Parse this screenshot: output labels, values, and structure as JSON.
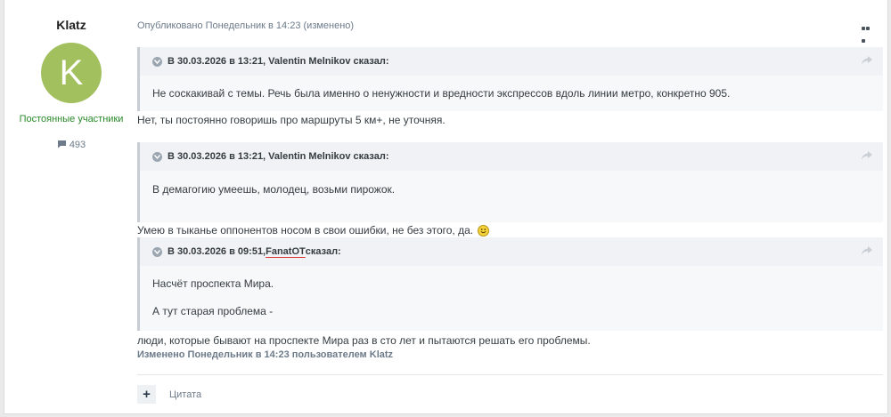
{
  "author": {
    "name": "Klatz",
    "avatar_letter": "K",
    "avatar_color": "#a3c05f",
    "group": "Постоянные участники",
    "post_count": "493"
  },
  "post": {
    "published": "Опубликовано Понедельник в 14:23 (изменено)",
    "quotes": [
      {
        "header": "В 30.03.2026 в 13:21, Valentin Melnikov сказал:",
        "body": [
          "Не соскакивай с темы. Речь была именно о ненужности и вредности экспрессов вдоль линии метро, конкретно 905."
        ]
      },
      {
        "header": "В 30.03.2026 в 13:21, Valentin Melnikov сказал:",
        "body": [
          "В демагогию умеешь, молодец, возьми пирожок."
        ]
      },
      {
        "header_prefix": "В 30.03.2026 в 09:51, ",
        "header_mention": "FanatOT",
        "header_suffix": " сказал:",
        "body": [
          "Насчёт проспекта Мира.",
          "А тут старая проблема -"
        ]
      }
    ],
    "replies": [
      "Нет, ты постоянно говоришь про маршруты 5 км+, не уточняя.",
      "Умею в тыканье оппонентов носом в свои ошибки, не без этого, да.",
      "люди, которые бывают на проспекте Мира раз в сто лет и пытаются решать его проблемы."
    ],
    "edited_note": "Изменено Понедельник в 14:23 пользователем Klatz"
  },
  "actions": {
    "plus_label": "+",
    "quote_label": "Цитата"
  }
}
